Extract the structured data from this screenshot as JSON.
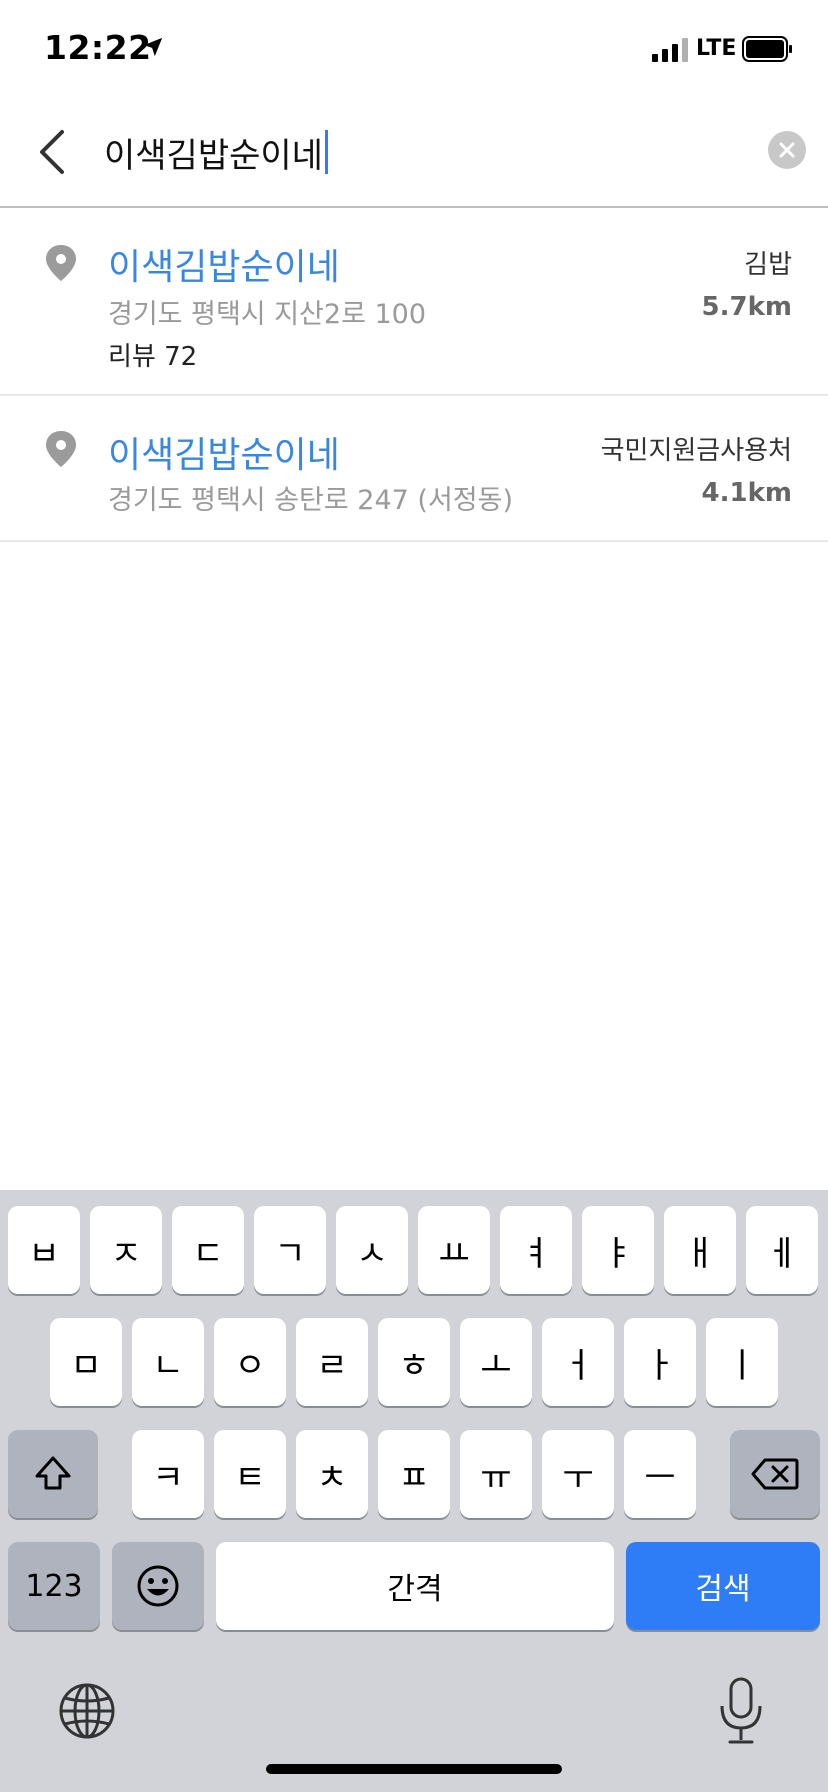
{
  "status_bar": {
    "time": "12:22",
    "network": "LTE",
    "icons": [
      "location-arrow-icon",
      "signal-icon",
      "battery-icon"
    ]
  },
  "search": {
    "query": "이색김밥순이네",
    "back_icon": "chevron-left-icon",
    "clear_icon": "clear-icon"
  },
  "results": [
    {
      "name": "이색김밥순이네",
      "address": "경기도 평택시 지산2로 100",
      "category": "김밥",
      "distance": "5.7km",
      "review": "리뷰 72"
    },
    {
      "name": "이색김밥순이네",
      "address": "경기도 평택시 송탄로 247 (서정동)",
      "category": "국민지원금사용처",
      "distance": "4.1km"
    }
  ],
  "keyboard": {
    "row1": [
      "ㅂ",
      "ㅈ",
      "ㄷ",
      "ㄱ",
      "ㅅ",
      "ㅛ",
      "ㅕ",
      "ㅑ",
      "ㅐ",
      "ㅔ"
    ],
    "row2": [
      "ㅁ",
      "ㄴ",
      "ㅇ",
      "ㄹ",
      "ㅎ",
      "ㅗ",
      "ㅓ",
      "ㅏ",
      "ㅣ"
    ],
    "row3": [
      "ㅋ",
      "ㅌ",
      "ㅊ",
      "ㅍ",
      "ㅠ",
      "ㅜ",
      "ㅡ"
    ],
    "numbers_label": "123",
    "space_label": "간격",
    "search_label": "검색",
    "accent_color": "#2f7df6"
  },
  "colors": {
    "result_name": "#3a87e0",
    "address": "#9a9a9a",
    "keyboard_bg": "#d1d3d9"
  }
}
